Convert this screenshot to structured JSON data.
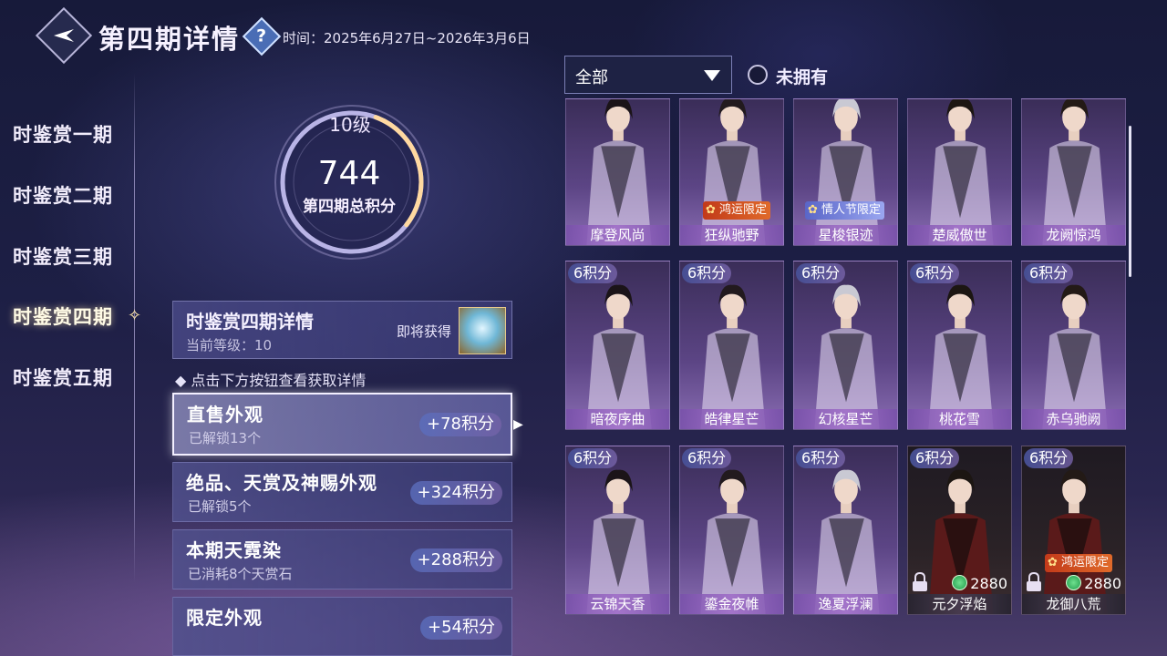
{
  "header": {
    "title": "第四期详情",
    "help_icon": "?",
    "time": "时间：2025年6月27日~2026年3月6日"
  },
  "nav": {
    "items": [
      {
        "label": "时鉴赏一期"
      },
      {
        "label": "时鉴赏二期"
      },
      {
        "label": "时鉴赏三期"
      },
      {
        "label": "时鉴赏四期",
        "active": true
      },
      {
        "label": "时鉴赏五期"
      }
    ]
  },
  "score": {
    "level": "10级",
    "points": "744",
    "label": "第四期总积分",
    "progress": 0.3
  },
  "detail": {
    "title": "时鉴赏四期详情",
    "current_level": "当前等级：10",
    "soon_label": "即将获得",
    "hint": "◆ 点击下方按钮查看获取详情"
  },
  "categories": [
    {
      "title": "直售外观",
      "sub": "已解锁13个",
      "points": "+78积分",
      "selected": true
    },
    {
      "title": "绝品、天赏及神赐外观",
      "sub": "已解锁5个",
      "points": "+324积分"
    },
    {
      "title": "本期天霓染",
      "sub": "已消耗8个天赏石",
      "points": "+288积分"
    },
    {
      "title": "限定外观",
      "sub": "",
      "points": "+54积分"
    }
  ],
  "filter": {
    "select_value": "全部",
    "checkbox_label": "未拥有"
  },
  "cards": [
    {
      "name": "摩登风尚",
      "badge": "",
      "tag": ""
    },
    {
      "name": "狂纵驰野",
      "badge": "",
      "tag": "鸿运限定"
    },
    {
      "name": "星梭银迹",
      "badge": "",
      "tag": "情人节限定"
    },
    {
      "name": "楚威傲世",
      "badge": "",
      "tag": ""
    },
    {
      "name": "龙阙惊鸿",
      "badge": "",
      "tag": ""
    },
    {
      "name": "暗夜序曲",
      "badge": "6积分",
      "tag": ""
    },
    {
      "name": "皓律星芒",
      "badge": "6积分",
      "tag": ""
    },
    {
      "name": "幻核星芒",
      "badge": "6积分",
      "tag": ""
    },
    {
      "name": "桃花雪",
      "badge": "6积分",
      "tag": ""
    },
    {
      "name": "赤乌驰阙",
      "badge": "6积分",
      "tag": ""
    },
    {
      "name": "云锦天香",
      "badge": "6积分",
      "tag": ""
    },
    {
      "name": "鎏金夜帷",
      "badge": "6积分",
      "tag": ""
    },
    {
      "name": "逸夏浮澜",
      "badge": "6积分",
      "tag": ""
    },
    {
      "name": "元夕浮焰",
      "badge": "6积分",
      "tag": "",
      "locked": true,
      "price": "2880"
    },
    {
      "name": "龙御八荒",
      "badge": "6积分",
      "tag": "鸿运限定",
      "locked": true,
      "price": "2880"
    }
  ],
  "colors": {
    "accent_gold": "#ffe6a8",
    "card_purple": "#8a6db3",
    "badge_red": "#c23a1a"
  }
}
